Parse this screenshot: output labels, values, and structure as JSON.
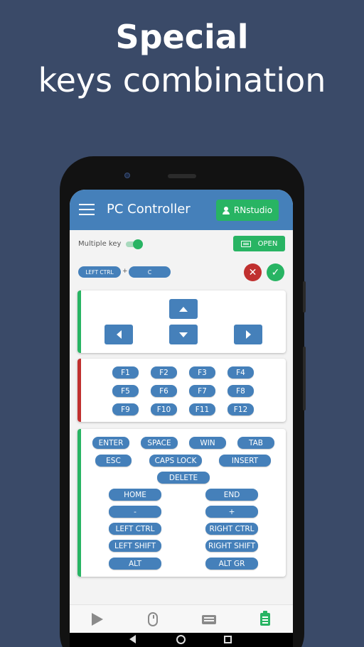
{
  "promo": {
    "title_bold": "Special",
    "title_light": "keys combination"
  },
  "colors": {
    "background": "#3a4a68",
    "primary": "#4580ba",
    "accent_green": "#28b463",
    "accent_red": "#c0302f"
  },
  "appbar": {
    "title": "PC Controller",
    "user_button": "RNstudio"
  },
  "controls": {
    "multiple_key_label": "Multiple key",
    "multiple_key_on": true,
    "open_button": "OPEN"
  },
  "combo": {
    "key1": "LEFT CTRL",
    "plus": "+",
    "key2": "C"
  },
  "function_keys": [
    "F1",
    "F2",
    "F3",
    "F4",
    "F5",
    "F6",
    "F7",
    "F8",
    "F9",
    "F10",
    "F11",
    "F12"
  ],
  "special_keys": {
    "row1": [
      "ENTER",
      "SPACE",
      "WIN",
      "TAB"
    ],
    "row2": [
      "ESC",
      "CAPS LOCK",
      "INSERT"
    ],
    "delete": "DELETE",
    "pairs": [
      [
        "HOME",
        "END"
      ],
      [
        "-",
        "+"
      ],
      [
        "LEFT CTRL",
        "RIGHT CTRL"
      ],
      [
        "LEFT SHIFT",
        "RIGHT SHIFT"
      ],
      [
        "ALT",
        "ALT GR"
      ]
    ]
  },
  "bottom_nav": {
    "items": [
      "play-icon",
      "mouse-icon",
      "keyboard-icon",
      "clipboard-icon"
    ],
    "active": 3
  }
}
